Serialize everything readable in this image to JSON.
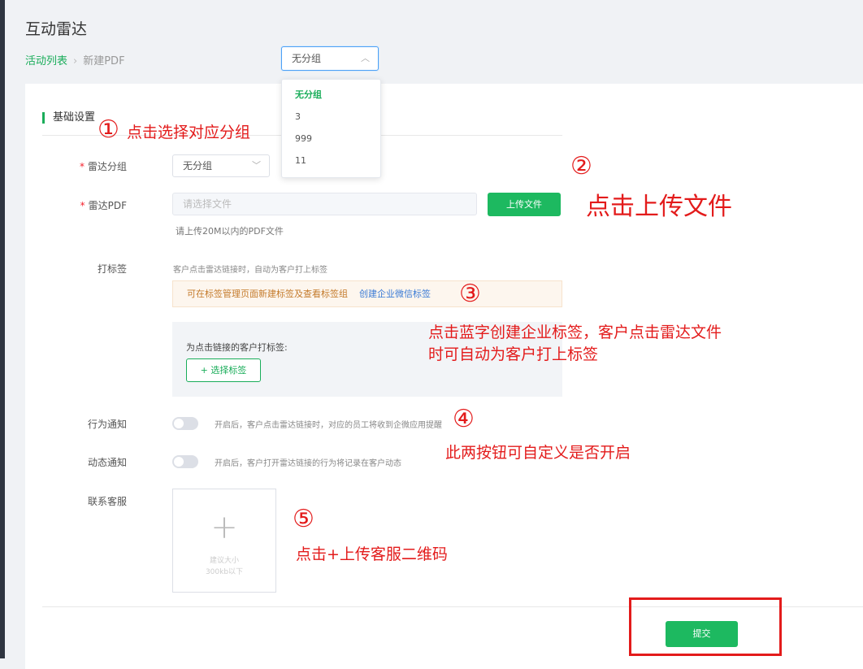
{
  "header": {
    "title": "互动雷达",
    "breadcrumb": {
      "link": "活动列表",
      "separator": "›",
      "current": "新建PDF"
    }
  },
  "group_filter": {
    "selected": "无分组",
    "options": [
      "无分组",
      "3",
      "999",
      "11"
    ]
  },
  "form": {
    "section_title": "基础设置",
    "required_mark": "*",
    "radar_group": {
      "label": "雷达分组",
      "value": "无分组"
    },
    "radar_pdf": {
      "label": "雷达PDF",
      "placeholder": "请选择文件",
      "upload_button": "上传文件",
      "hint": "请上传20M以内的PDF文件"
    },
    "tagging": {
      "label": "打标签",
      "description": "客户点击雷达链接时，自动为客户打上标签",
      "tip_text": "可在标签管理页面新建标签及查看标签组",
      "tip_link": "创建企业微信标签",
      "panel_text": "为点击链接的客户打标签:",
      "select_button": "+ 选择标签"
    },
    "behavior_notify": {
      "label": "行为通知",
      "desc": "开启后，客户点击雷达链接时，对应的员工将收到企微应用提醒",
      "enabled": false
    },
    "dynamic_notify": {
      "label": "动态通知",
      "desc": "开启后，客户打开雷达链接的行为将记录在客户动态",
      "enabled": false
    },
    "contact_service": {
      "label": "联系客服",
      "upload_icon": "plus-icon",
      "hint_line1": "建议大小",
      "hint_line2": "300kb以下"
    },
    "submit_label": "提交"
  },
  "annotations": {
    "step1": {
      "num": "①",
      "text": "点击选择对应分组"
    },
    "step2": {
      "num": "②",
      "text": "点击上传文件"
    },
    "step3": {
      "num": "③",
      "line1": "点击蓝字创建企业标签，客户点击雷达文件",
      "line2": "时可自动为客户打上标签"
    },
    "step4": {
      "num": "④",
      "text": "此两按钮可自定义是否开启"
    },
    "step5": {
      "num": "⑤",
      "text": "点击+上传客服二维码"
    }
  },
  "colors": {
    "primary": "#1db960",
    "link": "#3a7bd5",
    "annotation": "#e31b1b",
    "tip_background": "#fdf6ee"
  }
}
